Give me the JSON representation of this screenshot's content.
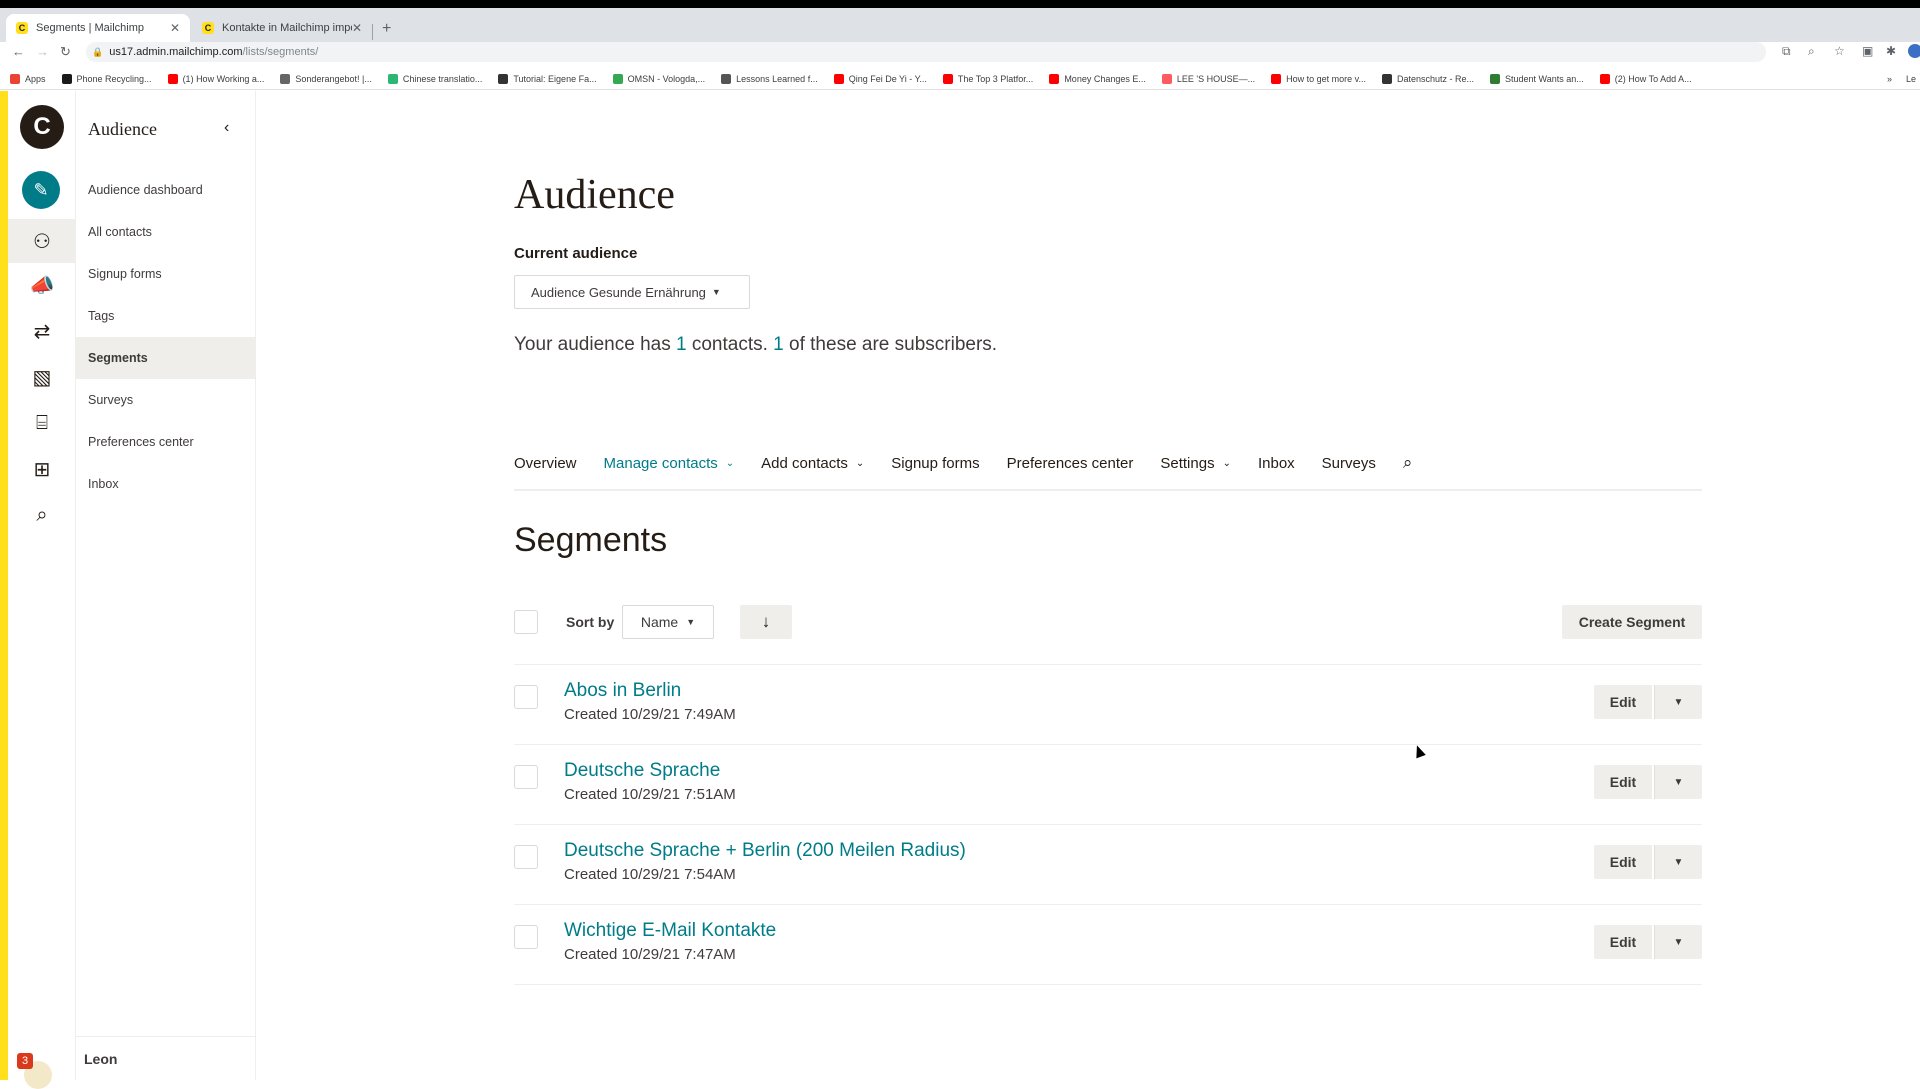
{
  "browser": {
    "tabs": [
      {
        "title": "Segments | Mailchimp",
        "active": true
      },
      {
        "title": "Kontakte in Mailchimp importi...",
        "active": false
      }
    ],
    "url_host": "us17.admin.mailchimp.com",
    "url_path": "/lists/segments/",
    "bookmarks": [
      {
        "label": "Apps",
        "color": "#ea4335"
      },
      {
        "label": "Phone Recycling...",
        "color": "#1a1a1a"
      },
      {
        "label": "(1) How Working a...",
        "color": "#ff0000"
      },
      {
        "label": "Sonderangebot! |...",
        "color": "#666666"
      },
      {
        "label": "Chinese translatio...",
        "color": "#2bb673"
      },
      {
        "label": "Tutorial: Eigene Fa...",
        "color": "#333333"
      },
      {
        "label": "OMSN - Vologda,...",
        "color": "#34a853"
      },
      {
        "label": "Lessons Learned f...",
        "color": "#555555"
      },
      {
        "label": "Qing Fei De Yi - Y...",
        "color": "#ff0000"
      },
      {
        "label": "The Top 3 Platfor...",
        "color": "#ff0000"
      },
      {
        "label": "Money Changes E...",
        "color": "#ff0000"
      },
      {
        "label": "LEE 'S HOUSE—...",
        "color": "#ff5a5f"
      },
      {
        "label": "How to get more v...",
        "color": "#ff0000"
      },
      {
        "label": "Datenschutz - Re...",
        "color": "#333333"
      },
      {
        "label": "Student Wants an...",
        "color": "#2e7d32"
      },
      {
        "label": "(2) How To Add A...",
        "color": "#ff0000"
      }
    ],
    "bookmarks_more": "»",
    "reading_list": "Le"
  },
  "rail": {
    "icons": [
      "create-icon",
      "audience-icon",
      "campaigns-icon",
      "automations-icon",
      "website-icon",
      "content-icon",
      "integrations-icon",
      "search-icon"
    ],
    "notification_count": "3"
  },
  "subnav": {
    "title": "Audience",
    "items": [
      {
        "label": "Audience dashboard",
        "selected": false
      },
      {
        "label": "All contacts",
        "selected": false
      },
      {
        "label": "Signup forms",
        "selected": false
      },
      {
        "label": "Tags",
        "selected": false
      },
      {
        "label": "Segments",
        "selected": true
      },
      {
        "label": "Surveys",
        "selected": false
      },
      {
        "label": "Preferences center",
        "selected": false
      },
      {
        "label": "Inbox",
        "selected": false
      }
    ],
    "user_name": "Leon"
  },
  "main": {
    "title": "Audience",
    "current_audience_label": "Current audience",
    "current_audience_value": "Audience Gesunde Ernährung",
    "summary": {
      "prefix": "Your audience has ",
      "contacts": "1",
      "middle": " contacts. ",
      "subscribers": "1",
      "suffix": " of these are subscribers."
    },
    "tabs": [
      {
        "label": "Overview",
        "dropdown": false,
        "active": false
      },
      {
        "label": "Manage contacts",
        "dropdown": true,
        "active": true
      },
      {
        "label": "Add contacts",
        "dropdown": true,
        "active": false
      },
      {
        "label": "Signup forms",
        "dropdown": false,
        "active": false
      },
      {
        "label": "Preferences center",
        "dropdown": false,
        "active": false
      },
      {
        "label": "Settings",
        "dropdown": true,
        "active": false
      },
      {
        "label": "Inbox",
        "dropdown": false,
        "active": false
      },
      {
        "label": "Surveys",
        "dropdown": false,
        "active": false
      }
    ],
    "section_title": "Segments",
    "sort_by_label": "Sort by",
    "sort_by_value": "Name",
    "create_segment_label": "Create Segment",
    "edit_label": "Edit",
    "segments": [
      {
        "name": "Abos in Berlin",
        "created": "Created 10/29/21 7:49AM"
      },
      {
        "name": "Deutsche Sprache",
        "created": "Created 10/29/21 7:51AM"
      },
      {
        "name": "Deutsche Sprache + Berlin (200 Meilen Radius)",
        "created": "Created 10/29/21 7:54AM"
      },
      {
        "name": "Wichtige E-Mail Kontakte",
        "created": "Created 10/29/21 7:47AM"
      }
    ]
  },
  "colors": {
    "brand_yellow": "#ffe01b",
    "accent_teal": "#007c89",
    "selected_bg": "#efeeea"
  }
}
